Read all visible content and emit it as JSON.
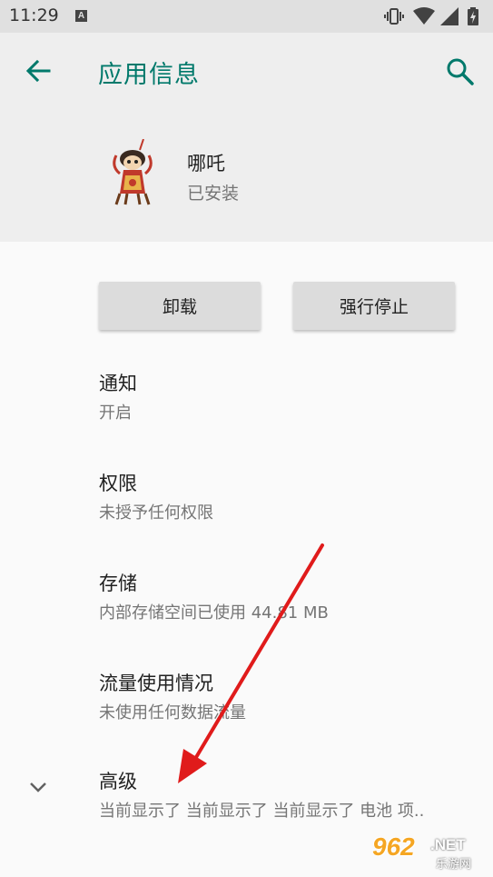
{
  "status_bar": {
    "time": "11:29",
    "icons": [
      "a-notification-icon",
      "vibrate-icon",
      "wifi-icon",
      "signal-icon",
      "battery-charging-icon"
    ]
  },
  "header": {
    "title": "应用信息",
    "back_icon": "arrow-back-icon",
    "search_icon": "search-icon",
    "accent_color": "#00796b"
  },
  "app": {
    "name": "哪吒",
    "status": "已安装"
  },
  "buttons": {
    "uninstall": "卸载",
    "force_stop": "强行停止"
  },
  "settings": [
    {
      "title": "通知",
      "subtitle": "开启"
    },
    {
      "title": "权限",
      "subtitle": "未授予任何权限"
    },
    {
      "title": "存储",
      "subtitle": "内部存储空间已使用 44.81 MB"
    },
    {
      "title": "流量使用情况",
      "subtitle": "未使用任何数据流量"
    },
    {
      "title": "高级",
      "subtitle": "当前显示了 当前显示了 当前显示了 电池 项.."
    }
  ],
  "watermark": {
    "number": "962",
    "net": ".NET",
    "sub": "乐游网"
  }
}
